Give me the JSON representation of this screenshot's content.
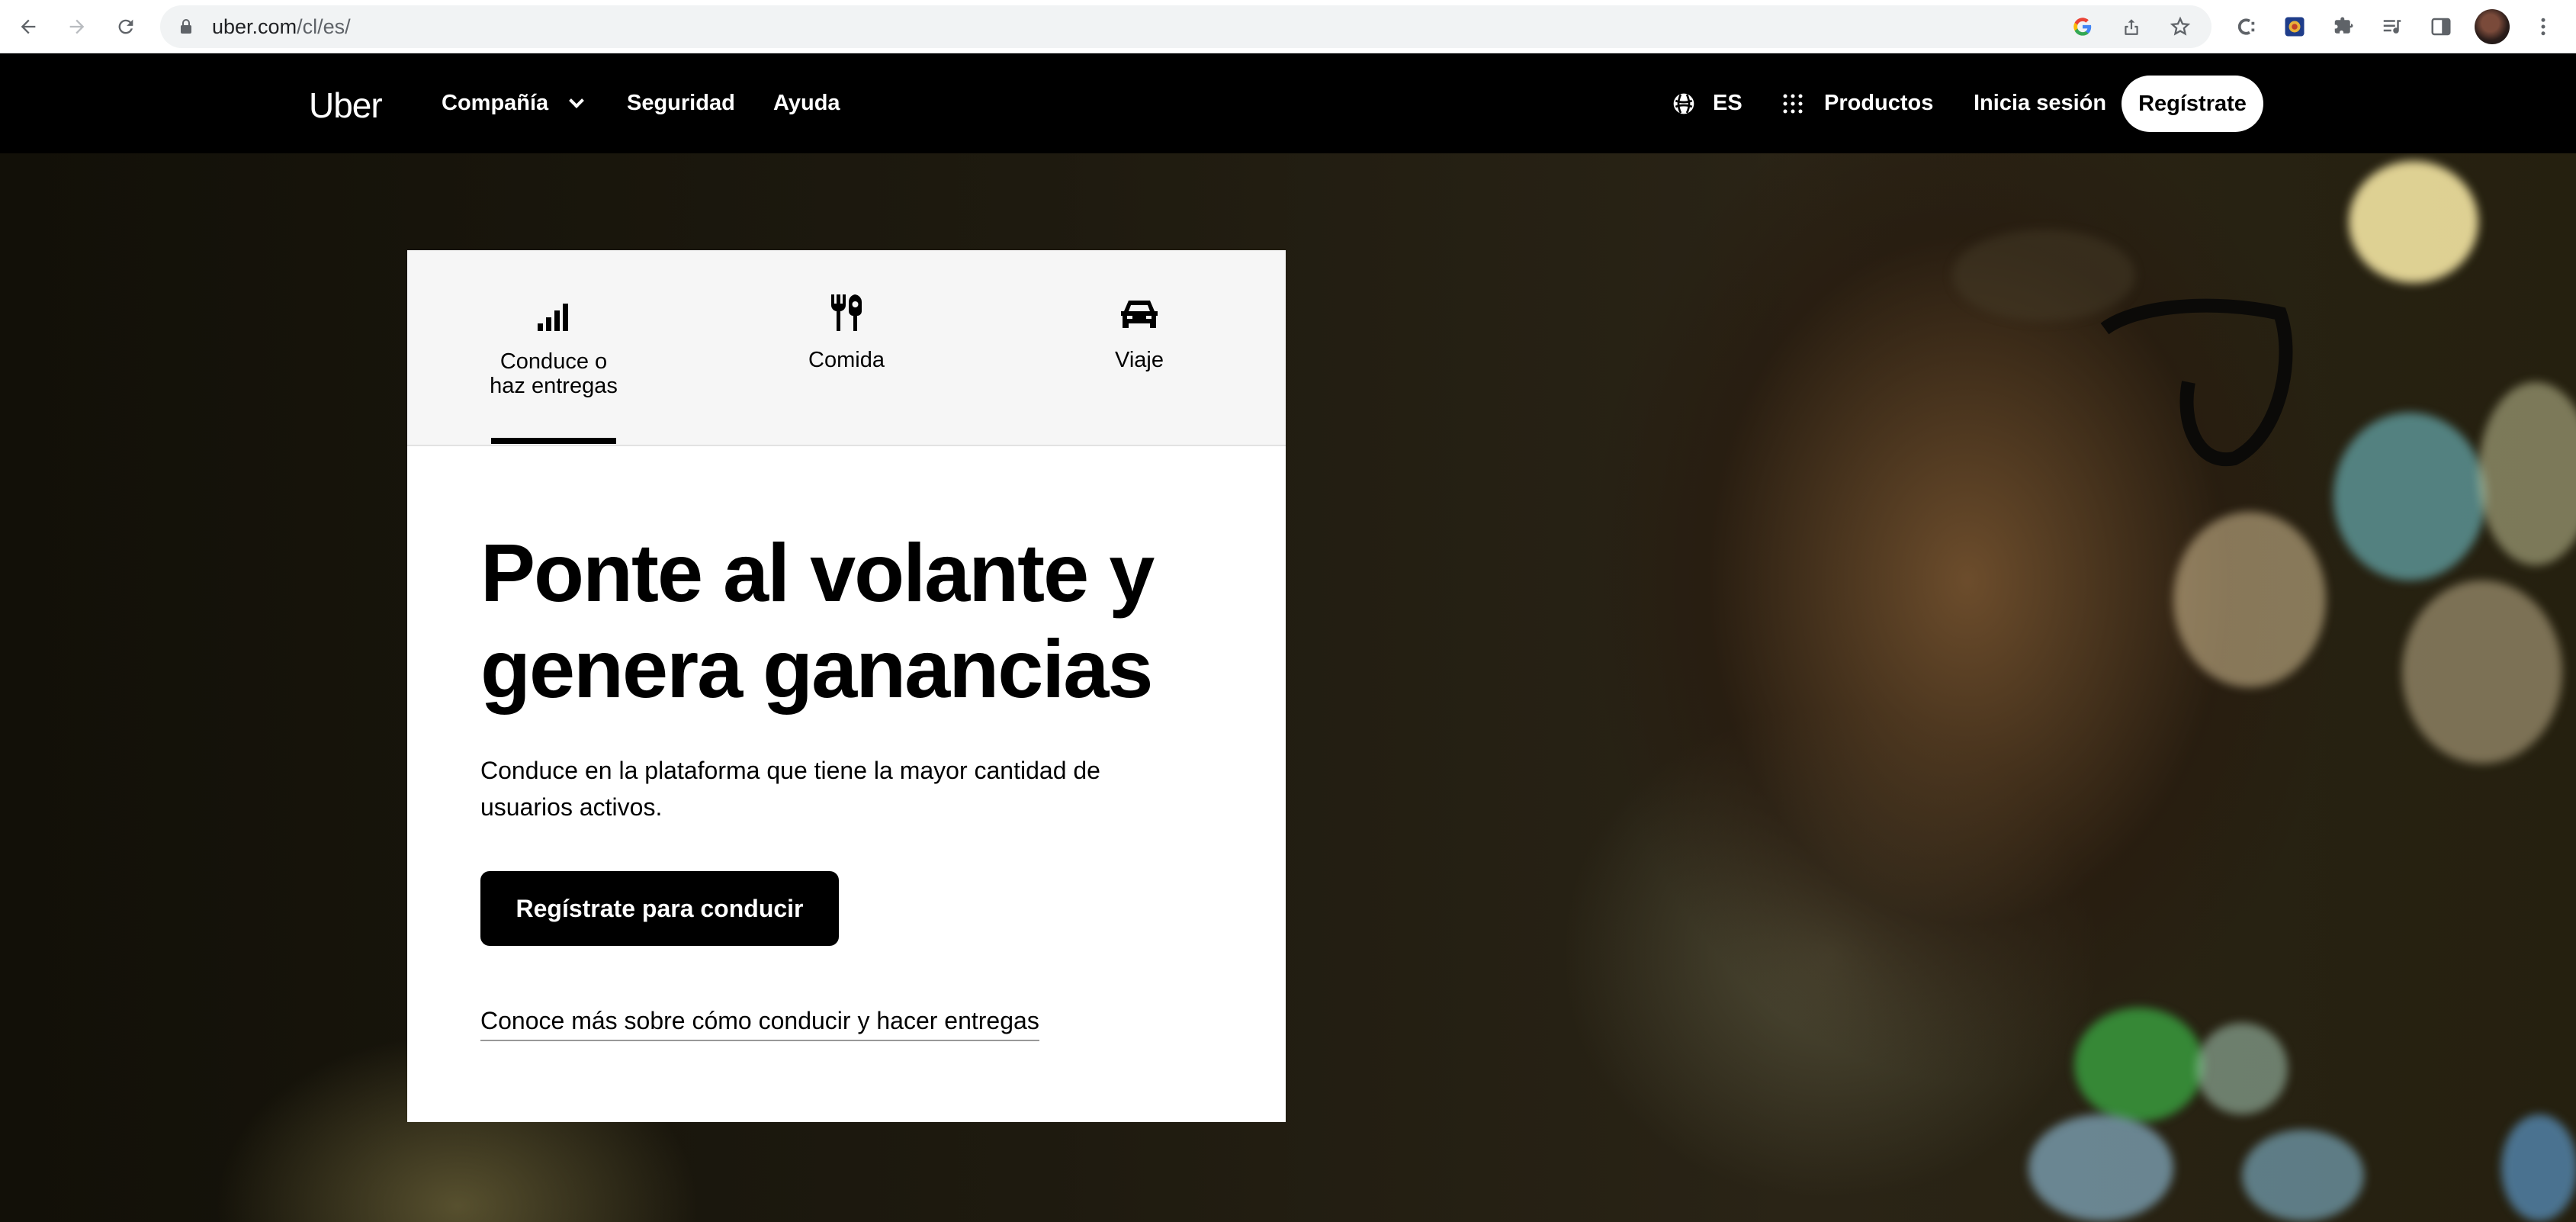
{
  "browser": {
    "url_host": "uber.com",
    "url_path": "/cl/es/",
    "back_icon": "arrow-left-icon",
    "forward_icon": "arrow-right-icon",
    "reload_icon": "reload-icon"
  },
  "header": {
    "logo": "Uber",
    "nav": {
      "company": "Compañía",
      "security": "Seguridad",
      "help": "Ayuda"
    },
    "language": "ES",
    "products": "Productos",
    "login": "Inicia sesión",
    "signup": "Regístrate"
  },
  "tabs": [
    {
      "label": "Conduce o haz entregas",
      "icon": "signal-bars-icon",
      "active": true
    },
    {
      "label": "Comida",
      "icon": "fork-knife-icon",
      "active": false
    },
    {
      "label": "Viaje",
      "icon": "car-icon",
      "active": false
    }
  ],
  "hero": {
    "headline": "Ponte al volante y genera ganancias",
    "subtext": "Conduce en la plataforma que tiene la mayor cantidad de usuarios activos.",
    "cta": "Regístrate para conducir",
    "learn_more": "Conoce más sobre cómo conducir y hacer entregas"
  },
  "colors": {
    "header_bg": "#000000",
    "card_bg": "#ffffff",
    "tab_bg": "#f6f6f6",
    "cta_bg": "#000000"
  }
}
